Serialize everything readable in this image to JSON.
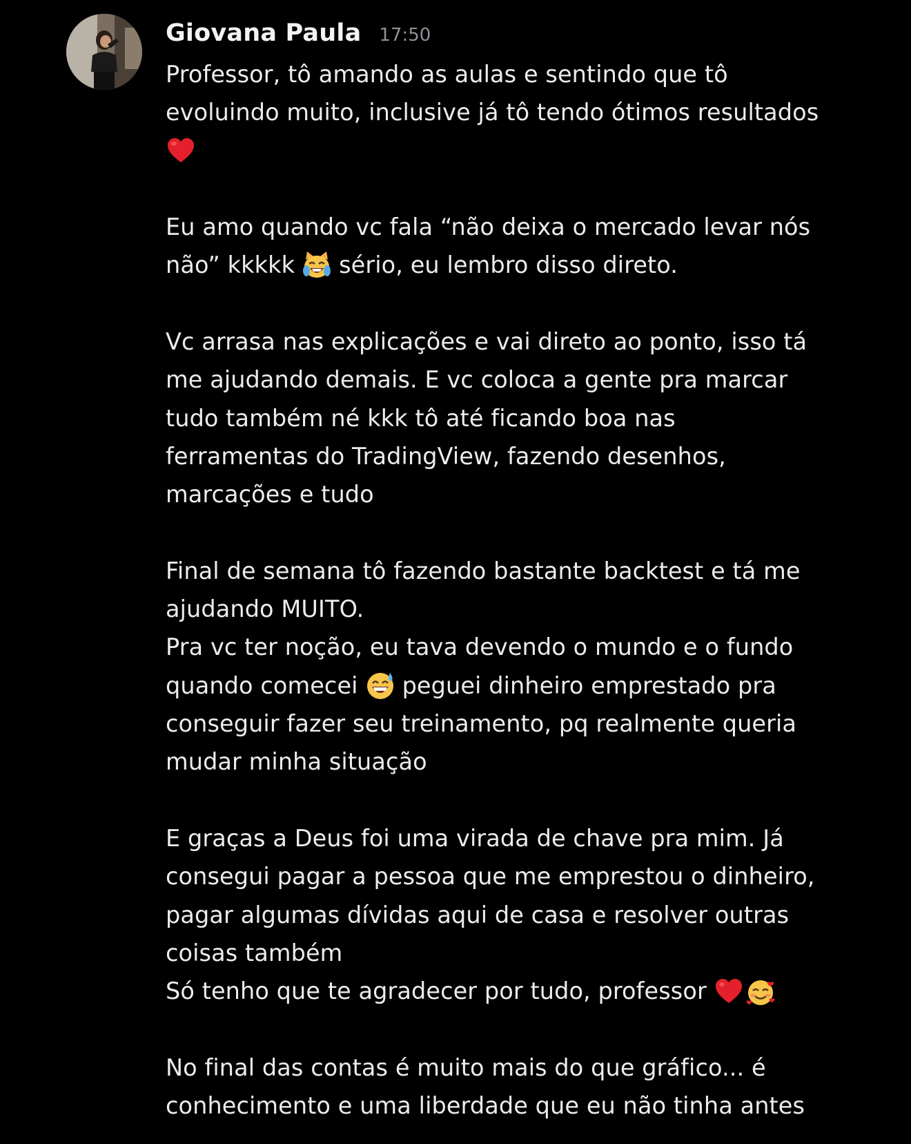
{
  "message": {
    "author": "Giovana Paula",
    "timestamp": "17:50",
    "avatar_icon": "profile-photo",
    "lines": {
      "l1": "Professor, tô amando as aulas e sentindo que tô",
      "l2": "evoluindo muito, inclusive já tô tendo ótimos resultados",
      "l4": "Eu amo quando vc fala “não deixa o mercado levar nós",
      "l5a": "não” kkkkk",
      "l5b": "sério, eu lembro disso direto.",
      "l6": "Vc arrasa nas explicações e vai direto ao ponto, isso tá",
      "l7": "me ajudando demais. E vc coloca a gente pra marcar",
      "l8": "tudo também né kkk tô até ficando boa nas",
      "l9": "ferramentas do TradingView, fazendo desenhos,",
      "l10": "marcações e tudo",
      "l11": "Final de semana tô fazendo bastante backtest e tá me",
      "l12": "ajudando MUITO.",
      "l13": "Pra vc ter noção, eu tava devendo o mundo e o fundo",
      "l14a": "quando comecei",
      "l14b": "peguei dinheiro emprestado pra",
      "l15": "conseguir fazer seu treinamento, pq realmente queria",
      "l16": "mudar minha situação",
      "l17": "E graças a Deus foi uma virada de chave pra mim. Já",
      "l18": "consegui pagar a pessoa que me emprestou o dinheiro,",
      "l19": "pagar algumas dívidas aqui de casa e resolver outras",
      "l20": "coisas também",
      "l21": "Só tenho que te agradecer por tudo, professor",
      "l22": "No final das contas é muito mais do que gráfico... é",
      "l23": "conhecimento e uma liberdade que eu não tinha antes"
    },
    "emojis": {
      "e1": "red-heart-emoji",
      "e2": "cat-tears-of-joy-emoji",
      "e3": "grinning-sweat-emoji",
      "e4": "red-heart-emoji",
      "e5": "smiling-face-with-hearts-emoji"
    }
  },
  "colors": {
    "background": "#000000",
    "text": "#ececec",
    "author": "#f2f3f5",
    "timestamp": "#8e9297",
    "heart": "#e3202b"
  }
}
